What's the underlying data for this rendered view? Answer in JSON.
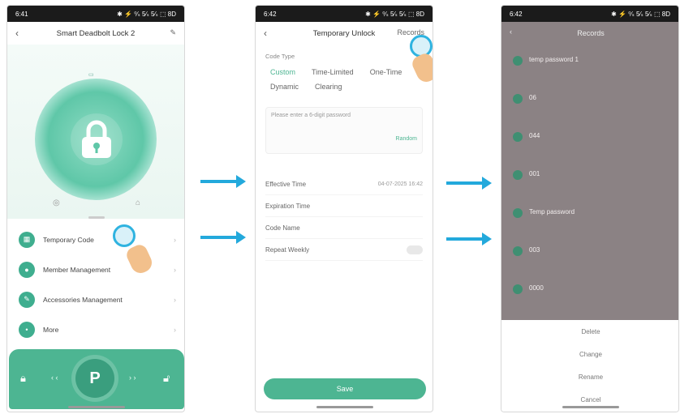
{
  "status": {
    "p1_time": "6:41",
    "p2_time": "6:42",
    "p3_time": "6:42",
    "right": "✱ ⚡ ⁰⁄ₛ 5⁄ₛ 5⁄ₛ ⬚ 8D"
  },
  "phone1": {
    "title": "Smart Deadbolt Lock 2",
    "menu": [
      {
        "label": "Temporary Code",
        "icon": "grid-icon"
      },
      {
        "label": "Member Management",
        "icon": "person-icon"
      },
      {
        "label": "Accessories Management",
        "icon": "wrench-icon"
      },
      {
        "label": "More",
        "icon": "dots-icon"
      }
    ],
    "center_button": "P"
  },
  "phone2": {
    "title": "Temporary Unlock",
    "nav_right": "Records",
    "code_type_label": "Code Type",
    "code_types": [
      "Custom",
      "Time-Limited",
      "One-Time",
      "Dynamic",
      "Clearing"
    ],
    "password_hint": "Please enter a 6-digit password",
    "generate": "Random",
    "rows": [
      {
        "label": "Effective Time",
        "value": "04-07-2025 16:42"
      },
      {
        "label": "Expiration Time",
        "value": ""
      },
      {
        "label": "Code Name",
        "value": ""
      },
      {
        "label": "Repeat Weekly",
        "value": ""
      }
    ],
    "save": "Save"
  },
  "phone3": {
    "title": "Records",
    "records": [
      {
        "name": "temp password 1"
      },
      {
        "name": "06"
      },
      {
        "name": "044"
      },
      {
        "name": "001"
      },
      {
        "name": "Temp password"
      },
      {
        "name": "003"
      },
      {
        "name": "0000"
      }
    ],
    "sheet": [
      "Delete",
      "Change",
      "Rename",
      "Cancel"
    ]
  }
}
